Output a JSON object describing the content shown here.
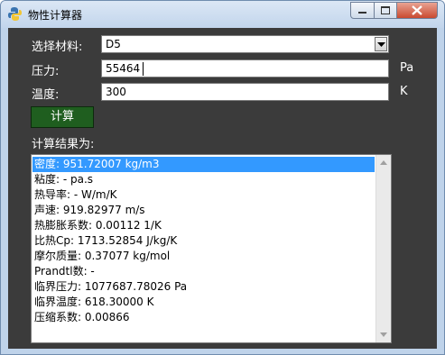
{
  "window": {
    "title": "物性计算器"
  },
  "form": {
    "material_label": "选择材料:",
    "material_value": "D5",
    "pressure_label": "压力:",
    "pressure_value": "55464",
    "pressure_unit": "Pa",
    "temperature_label": "温度:",
    "temperature_value": "300",
    "temperature_unit": "K",
    "calc_button": "计算"
  },
  "results": {
    "label": "计算结果为:",
    "items": [
      "密度: 951.72007 kg/m3",
      "粘度: - pa.s",
      "热导率: - W/m/K",
      "声速: 919.82977 m/s",
      "热膨胀系数: 0.00112 1/K",
      "比热Cp: 1713.52854 J/kg/K",
      "摩尔质量: 0.37077 kg/mol",
      "Prandtl数: -",
      "临界压力: 1077687.78026 Pa",
      "临界温度: 618.30000 K",
      "压缩系数: 0.00866"
    ],
    "selected_index": 0
  },
  "icons": {
    "app": "app-icon",
    "minimize": "minimize-icon",
    "maximize": "maximize-icon",
    "close": "close-icon",
    "dropdown": "chevron-down-icon"
  },
  "colors": {
    "client_bg": "#3b3b3b",
    "button_bg": "#1f5e1f",
    "selection": "#3399ff"
  }
}
